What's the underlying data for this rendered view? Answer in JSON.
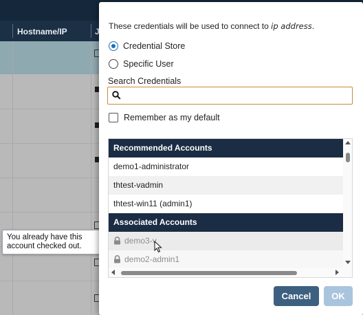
{
  "background": {
    "columns": [
      "Hostname/IP",
      "J"
    ]
  },
  "tooltip": {
    "line1": "You already have this",
    "line2": "account checked out."
  },
  "dialog": {
    "info_prefix": "These credentials will be used to connect to ",
    "info_target": "ip address",
    "info_suffix": ".",
    "radio_options": [
      {
        "label": "Credential Store",
        "checked": true
      },
      {
        "label": "Specific User",
        "checked": false
      }
    ],
    "search": {
      "label": "Search Credentials",
      "value": "",
      "placeholder": ""
    },
    "remember_label": "Remember as my default",
    "groups": [
      {
        "title": "Recommended Accounts",
        "items": [
          "demo1-administrator",
          "thtest-vadmin",
          "thtest-win11 (admin1)"
        ]
      },
      {
        "title": "Associated Accounts",
        "items": [
          "demo3-v",
          "demo2-admin1"
        ]
      }
    ],
    "buttons": {
      "cancel": "Cancel",
      "ok": "OK"
    }
  },
  "colors": {
    "header_navy": "#1b2d44",
    "accent_blue": "#1d6fb8",
    "search_border": "#c98a3a",
    "cancel_bg": "#3d6080",
    "ok_bg_disabled": "#a9c4dd"
  }
}
